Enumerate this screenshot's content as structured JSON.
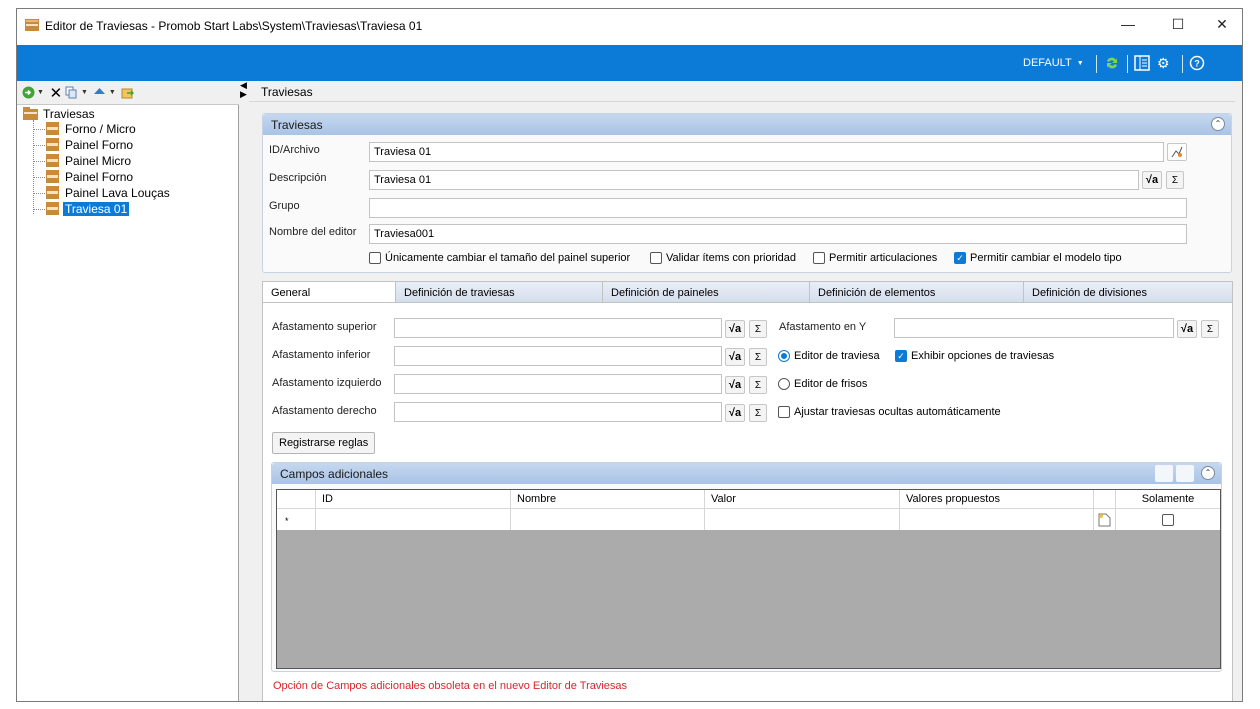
{
  "window": {
    "title": "Editor de Traviesas - Promob Start Labs\\System\\Traviesas\\Traviesa 01",
    "minimize": "—",
    "maximize": "☐",
    "close": "✕"
  },
  "ribbon": {
    "profile": "DEFAULT",
    "accent": "#0c7bd8"
  },
  "tree": {
    "root": "Traviesas",
    "items": [
      {
        "label": "Forno / Micro"
      },
      {
        "label": "Painel Forno"
      },
      {
        "label": "Painel Micro"
      },
      {
        "label": "Painel Forno"
      },
      {
        "label": "Painel Lava Louças"
      },
      {
        "label": "Traviesa 01"
      }
    ]
  },
  "right_header": "Traviesas",
  "group": {
    "title": "Traviesas",
    "id_label": "ID/Archivo",
    "id_value": "Traviesa 01",
    "desc_label": "Descripción",
    "desc_value": "Traviesa 01",
    "grupo_label": "Grupo",
    "grupo_value": "",
    "editor_label": "Nombre del editor",
    "editor_value": "Traviesa001",
    "options": [
      {
        "label": "Únicamente cambiar el tamaño del painel superior",
        "checked": false
      },
      {
        "label": "Validar ítems con prioridad",
        "checked": false
      },
      {
        "label": "Permitir articulaciones",
        "checked": false
      },
      {
        "label": "Permitir cambiar el modelo tipo",
        "checked": true
      }
    ]
  },
  "tabs": [
    {
      "label": "General"
    },
    {
      "label": "Definición de traviesas"
    },
    {
      "label": "Definición de paineles"
    },
    {
      "label": "Definición de elementos"
    },
    {
      "label": "Definición de divisiones"
    }
  ],
  "general": {
    "sup_label": "Afastamento superior",
    "inf_label": "Afastamento inferior",
    "izq_label": "Afastamento izquierdo",
    "der_label": "Afastamento derecho",
    "y_label": "Afastamento en Y",
    "radio_traviesa": "Editor de traviesa",
    "radio_frisos": "Editor de frisos",
    "exhibir": "Exhibir opciones de traviesas",
    "ajustar": "Ajustar traviesas ocultas automáticamente",
    "register_btn": "Registrarse reglas",
    "fx": "√a",
    "sigma": "Σ"
  },
  "campos": {
    "title": "Campos adicionales",
    "columns": [
      "ID",
      "Nombre",
      "Valor",
      "Valores propuestos",
      "",
      "Solamente"
    ],
    "new_row_marker": "*",
    "warning": "Opción de Campos adicionales obsoleta en el nuevo Editor de Traviesas"
  }
}
